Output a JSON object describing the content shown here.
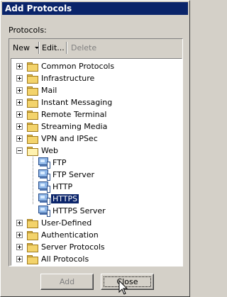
{
  "window": {
    "title": "Add Protocols"
  },
  "protocols_label": "Protocols:",
  "toolbar": {
    "new": "New",
    "edit": "Edit...",
    "delete": "Delete"
  },
  "tree": {
    "folders_top": [
      "Common Protocols",
      "Infrastructure",
      "Mail",
      "Instant Messaging",
      "Remote Terminal",
      "Streaming Media",
      "VPN and IPSec"
    ],
    "web": {
      "label": "Web",
      "children": [
        "FTP",
        "FTP Server",
        "HTTP",
        "HTTPS",
        "HTTPS Server"
      ],
      "selected": "HTTPS"
    },
    "folders_bottom": [
      "User-Defined",
      "Authentication",
      "Server Protocols",
      "All Protocols"
    ]
  },
  "buttons": {
    "add": "Add",
    "close": "Close"
  },
  "icons": {
    "folder": "folder-icon",
    "folder_open": "folder-open-icon",
    "protocol": "protocol-icon",
    "expander": "plus-box-icon",
    "collapse": "minus-box-icon"
  }
}
